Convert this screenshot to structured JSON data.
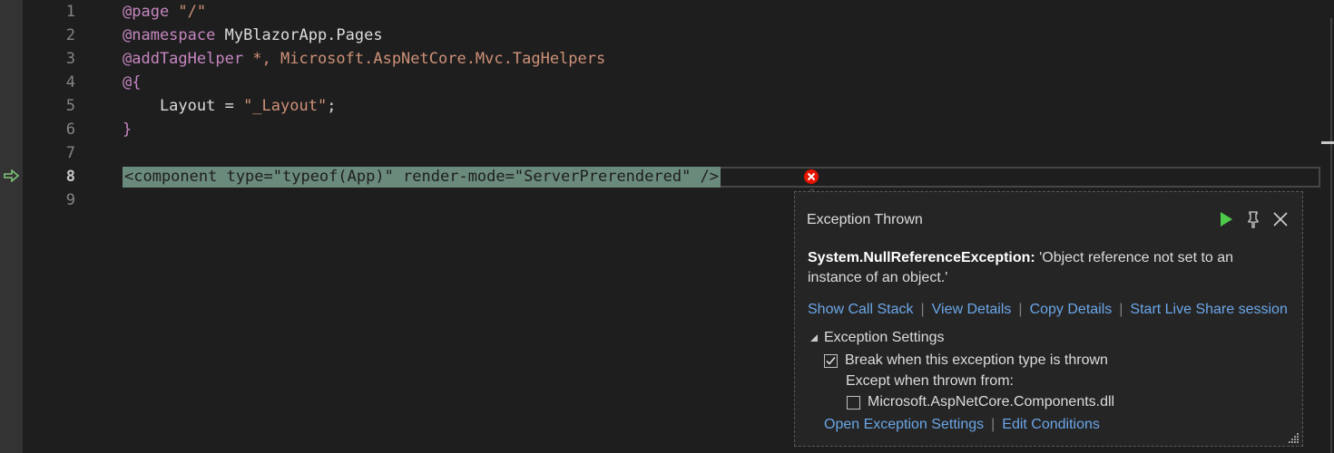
{
  "editor": {
    "line_numbers": [
      "1",
      "2",
      "3",
      "4",
      "5",
      "6",
      "7",
      "8",
      "9"
    ],
    "current_line": "8",
    "lines": {
      "l1": {
        "kw": "@page",
        "str": " \"/\""
      },
      "l2": {
        "kw": "@namespace",
        "plain": " MyBlazorApp.Pages"
      },
      "l3": {
        "kw": "@addTagHelper",
        "str": " *, Microsoft.AspNetCore.Mvc.TagHelpers"
      },
      "l4": {
        "kw": "@{"
      },
      "l5": {
        "plain": "    Layout = ",
        "str": "\"_Layout\"",
        "end": ";"
      },
      "l6": {
        "kw": "}"
      },
      "l8": {
        "text": "<component type=\"typeof(App)\" render-mode=\"ServerPrerendered\" />"
      }
    }
  },
  "popup": {
    "title": "Exception Thrown",
    "exception_type": "System.NullReferenceException:",
    "exception_message": " 'Object reference not set to an instance of an object.'",
    "links": [
      "Show Call Stack",
      "View Details",
      "Copy Details",
      "Start Live Share session"
    ],
    "settings_header": "Exception Settings",
    "break_label": "Break when this exception type is thrown",
    "break_checked": true,
    "except_label": "Except when thrown from:",
    "module_label": "Microsoft.AspNetCore.Components.dll",
    "module_checked": false,
    "bottom_links": [
      "Open Exception Settings",
      "Edit Conditions"
    ]
  },
  "icons": {
    "continue": "play-icon",
    "pin": "pin-icon",
    "close": "close-icon",
    "error": "error-icon",
    "execution_pointer": "execution-arrow-icon"
  },
  "colors": {
    "keyword": "#c586c0",
    "string": "#ce9178",
    "link": "#6ba6e6",
    "highlight": "#6a8a7b",
    "error": "#e51400"
  }
}
